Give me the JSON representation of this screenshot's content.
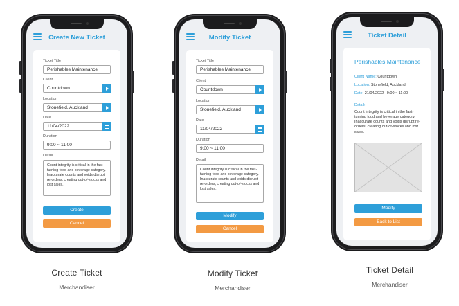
{
  "screens": [
    {
      "header_title": "Create New Ticket",
      "fields": {
        "title_label": "Ticket Title",
        "title_value": "Perishables Maintenance",
        "client_label": "Client",
        "client_value": "Countdown",
        "location_label": "Location",
        "location_value": "Stonefield, Auckland",
        "date_label": "Date",
        "date_value": "11/04/2022",
        "duration_label": "Duration",
        "duration_value": "9:00 ~ 11:00",
        "detail_label": "Detail",
        "detail_value": "Count integrity is critical in the fast-turning food and beverage category. Inaccurate counts and voids disrupt re-orders, creating out-of-stocks and lost sales."
      },
      "primary_button": "Create",
      "secondary_button": "Cancel",
      "caption": "Create Ticket",
      "role": "Merchandiser"
    },
    {
      "header_title": "Modify Ticket",
      "fields": {
        "title_label": "Ticket Title",
        "title_value": "Perishables Maintenance",
        "client_label": "Client",
        "client_value": "Countdown",
        "location_label": "Location",
        "location_value": "Stonefield, Auckland",
        "date_label": "Date",
        "date_value": "11/04/2022",
        "duration_label": "Duration",
        "duration_value": "9:00 ~ 11:00",
        "detail_label": "Detail",
        "detail_value": "Count integrity is critical in the fast-turning food and beverage category. Inaccurate counts and voids disrupt re-orders, creating out-of-stocks and lost sales."
      },
      "primary_button": "Modify",
      "secondary_button": "Cancel",
      "caption": "Modify Ticket",
      "role": "Merchandiser"
    },
    {
      "header_title": "Ticket Detail",
      "ticket_title": "Perishables Maintenance",
      "client_key": "Client Name:",
      "client_value": "Countdown",
      "location_key": "Location:",
      "location_value": "Stonefield, Auckland",
      "date_key": "Date:",
      "date_value": "21/04/2022   9:00 ~ 11:00",
      "detail_label": "Detail:",
      "detail_value": "Count integrity is critical in the fast-turning food and beverage category. Inaccurate counts and voids disrupt re-orders, creating out-of-stocks and lost sales.",
      "primary_button": "Modify",
      "secondary_button": "Back to List",
      "caption": "Ticket Detail",
      "role": "Merchandiser"
    }
  ],
  "colors": {
    "accent": "#2e9fd9",
    "cancel": "#f39a43",
    "phone_frame": "#1c1c1e",
    "screen_bg": "#eef0f3"
  },
  "icons": [
    "hamburger-menu-icon",
    "dropdown-arrow-icon",
    "calendar-icon",
    "image-placeholder-icon"
  ]
}
